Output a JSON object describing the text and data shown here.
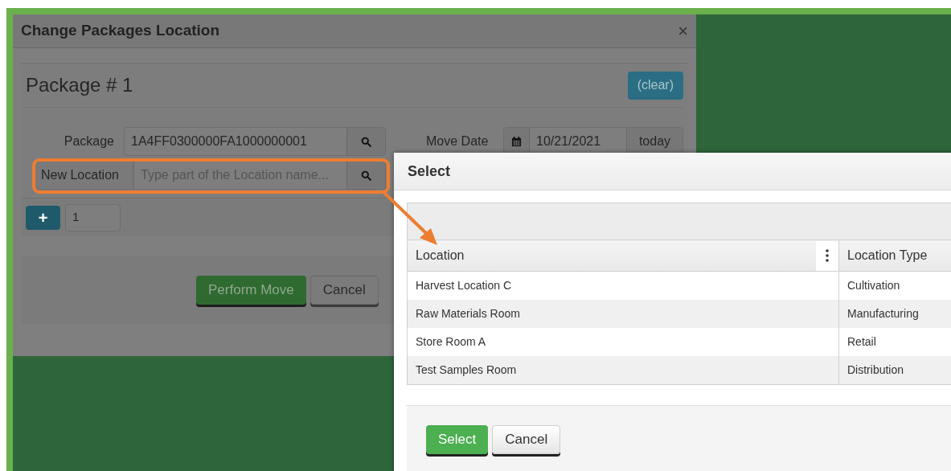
{
  "window": {
    "title": "Change Packages Location",
    "close": "×"
  },
  "package_section": {
    "title": "Package # 1",
    "clear_button": "(clear)",
    "package": {
      "label": "Package",
      "value": "1A4FF0300000FA1000000001"
    },
    "move_date": {
      "label": "Move Date",
      "value": "10/21/2021",
      "today_button": "today"
    },
    "new_location": {
      "label": "New Location",
      "placeholder": "Type part of the Location name..."
    },
    "add_button": "+",
    "count": "1"
  },
  "footer_buttons": [
    {
      "label": "Perform Move",
      "kind": "primary"
    },
    {
      "label": "Cancel",
      "kind": "default"
    }
  ],
  "select_dialog": {
    "title": "Select",
    "table": {
      "columns": [
        "Location",
        "Location Type"
      ],
      "rows": [
        [
          "Harvest Location C",
          "Cultivation"
        ],
        [
          "Raw Materials Room",
          "Manufacturing"
        ],
        [
          "Store Room A",
          "Retail"
        ],
        [
          "Test Samples Room",
          "Distribution"
        ]
      ]
    },
    "buttons": [
      {
        "label": "Select",
        "kind": "primary"
      },
      {
        "label": "Cancel",
        "kind": "default"
      }
    ]
  }
}
